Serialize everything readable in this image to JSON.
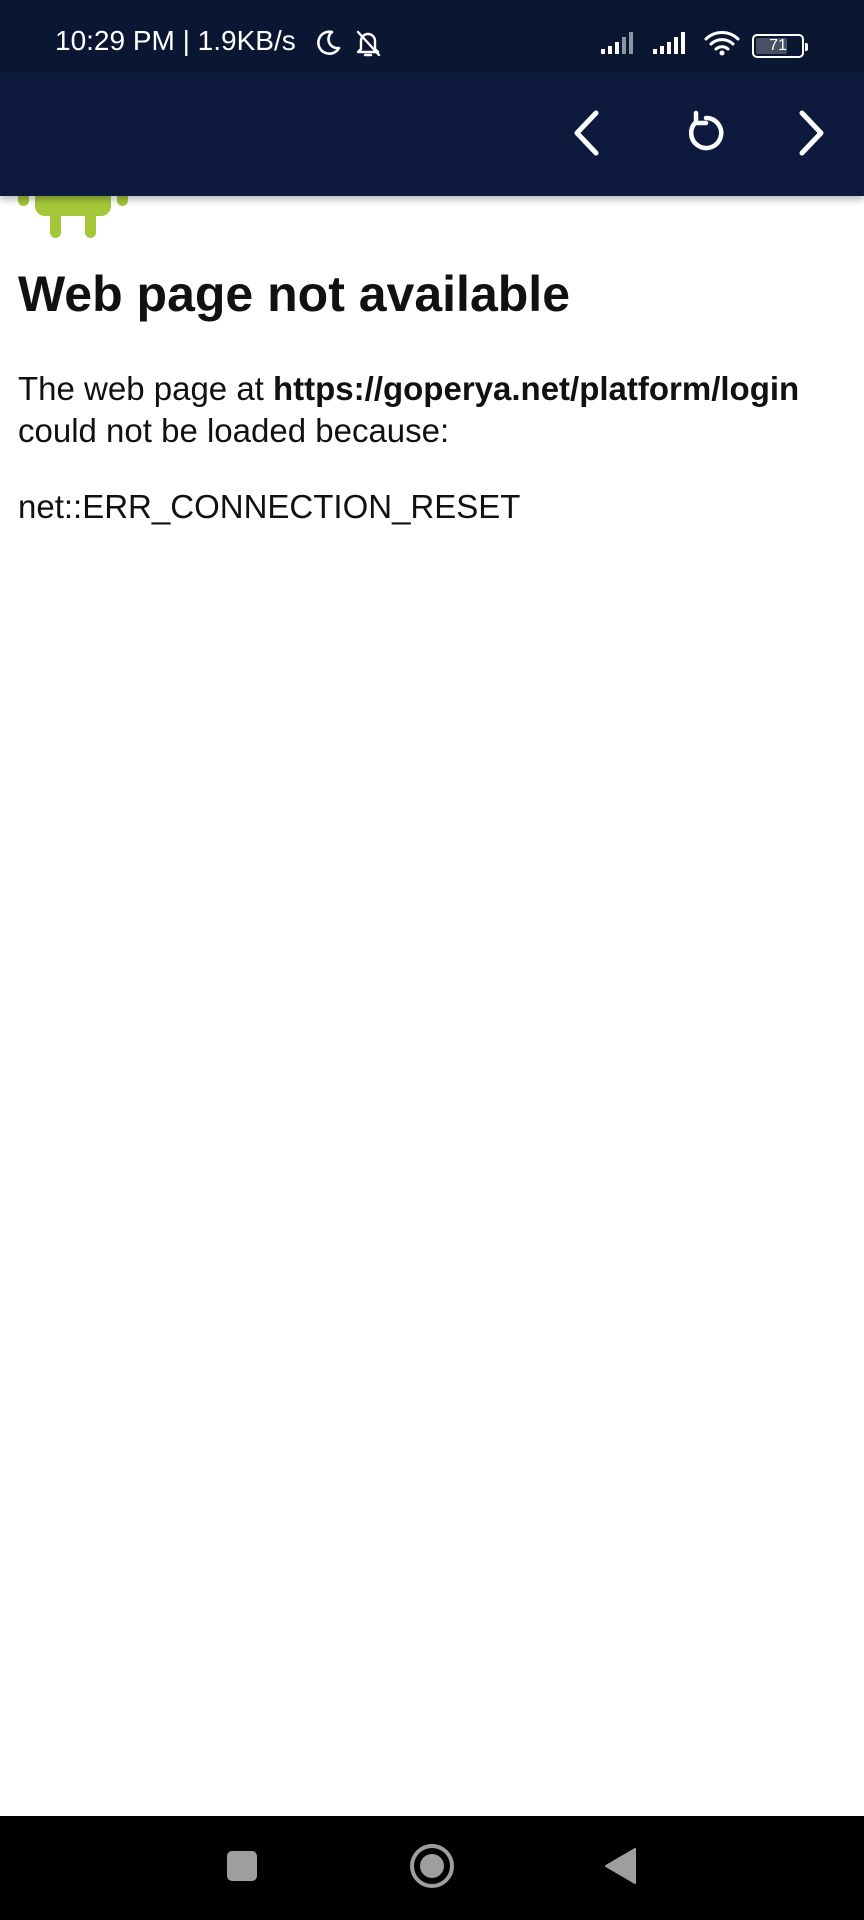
{
  "status_bar": {
    "time": "10:29 PM | 1.9KB/s",
    "icons": [
      "moon-icon",
      "bell-off-icon",
      "signal-icon",
      "signal-icon",
      "wifi-icon",
      "battery-icon"
    ],
    "battery_level": "71",
    "battery_fraction": 0.71
  },
  "toolbar": {
    "icons": [
      "chevron-left-icon",
      "reload-icon",
      "chevron-right-icon"
    ]
  },
  "error_page": {
    "title": "Web page not available",
    "message_prefix": "The web page at ",
    "url": "https://goperya.net/platform/login",
    "message_suffix": " could not be loaded because:",
    "error_code": "net::ERR_CONNECTION_RESET"
  },
  "nav_bar": {
    "icons": [
      "recents-icon",
      "home-icon",
      "back-icon"
    ]
  },
  "colors": {
    "status_bar_bg": "#0b1633",
    "toolbar_bg": "#0d1a3d",
    "android_green": "#a4c639",
    "text": "#111111",
    "nav_bar_bg": "#000000"
  }
}
